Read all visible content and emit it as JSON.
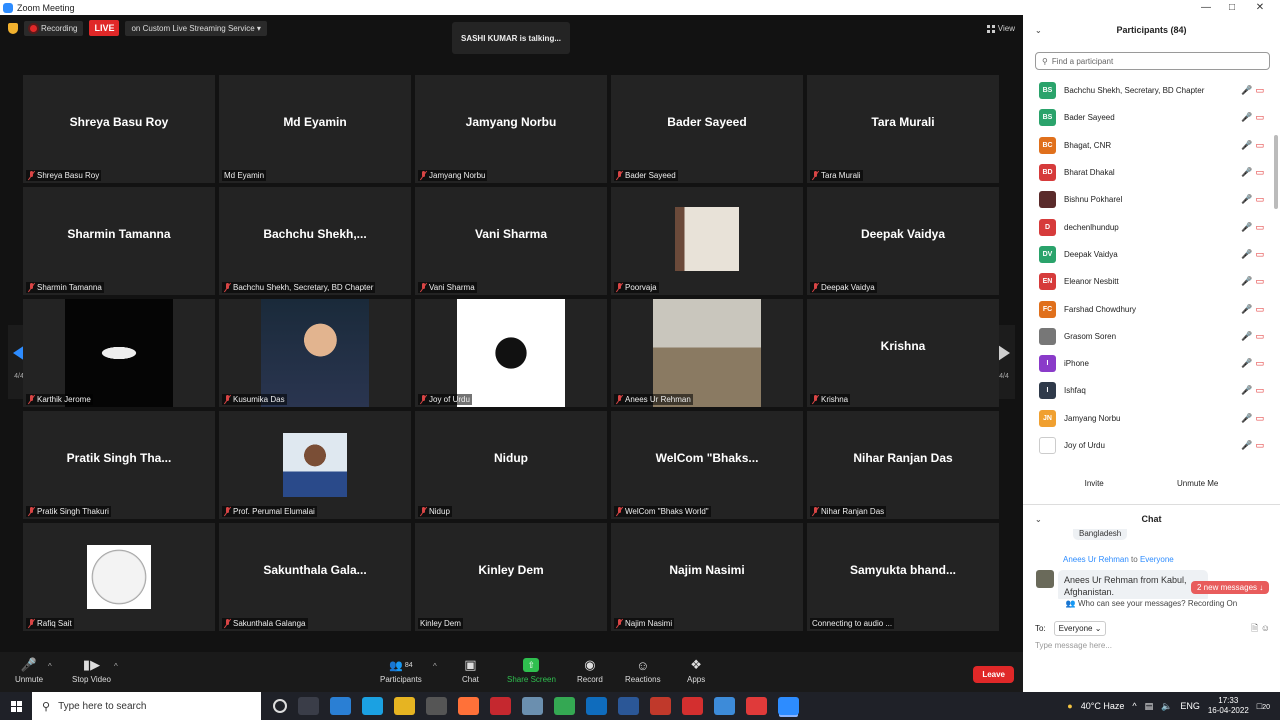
{
  "window": {
    "title": "Zoom Meeting"
  },
  "topbar": {
    "recording_label": "Recording",
    "live_label": "LIVE",
    "stream_label": "on Custom Live Streaming Service",
    "talking": "SASHI KUMAR is talking...",
    "view_label": "View"
  },
  "nav": {
    "page_left": "4/4",
    "page_right": "4/4"
  },
  "tiles": [
    {
      "big": "Shreya Basu Roy",
      "cap": "Shreya Basu Roy",
      "muted": true
    },
    {
      "big": "Md Eyamin",
      "cap": "Md Eyamin",
      "muted": false
    },
    {
      "big": "Jamyang Norbu",
      "cap": "Jamyang Norbu",
      "muted": true
    },
    {
      "big": "Bader Sayeed",
      "cap": "Bader Sayeed",
      "muted": true
    },
    {
      "big": "Tara Murali",
      "cap": "Tara Murali",
      "muted": true
    },
    {
      "big": "Sharmin Tamanna",
      "cap": "Sharmin Tamanna",
      "muted": true
    },
    {
      "big": "Bachchu  Shekh,...",
      "cap": "Bachchu Shekh, Secretary, BD Chapter",
      "muted": true
    },
    {
      "big": "Vani Sharma",
      "cap": "Vani Sharma",
      "muted": true
    },
    {
      "big": "",
      "cap": "Poorvaja",
      "muted": true,
      "pic": "photo-girl"
    },
    {
      "big": "Deepak Vaidya",
      "cap": "Deepak Vaidya",
      "muted": true
    },
    {
      "big": "",
      "cap": "Karthik Jerome",
      "muted": true,
      "pic": "batman"
    },
    {
      "big": "",
      "cap": "Kusumika Das",
      "muted": true,
      "pic": "photo-woman"
    },
    {
      "big": "",
      "cap": "Joy of Urdu",
      "muted": true,
      "pic": "urdu-logo"
    },
    {
      "big": "",
      "cap": "Anees Ur Rehman",
      "muted": true,
      "pic": "photo-landscape"
    },
    {
      "big": "Krishna",
      "cap": "Krishna",
      "muted": true
    },
    {
      "big": "Pratik Singh Tha...",
      "cap": "Pratik Singh Thakuri",
      "muted": true
    },
    {
      "big": "",
      "cap": "Prof. Perumal Elumalai",
      "muted": true,
      "pic": "photo-man"
    },
    {
      "big": "Nidup",
      "cap": "Nidup",
      "muted": true
    },
    {
      "big": "WelCom  \"Bhaks...",
      "cap": "WelCom \"Bhaks World\"",
      "muted": true
    },
    {
      "big": "Nihar Ranjan  Das",
      "cap": "Nihar Ranjan  Das",
      "muted": true
    },
    {
      "big": "",
      "cap": "Rafiq Sait",
      "muted": true,
      "pic": "football"
    },
    {
      "big": "Sakunthala  Gala...",
      "cap": "Sakunthala Galanga",
      "muted": true
    },
    {
      "big": "Kinley Dem",
      "cap": "Kinley Dem",
      "muted": false
    },
    {
      "big": "Najim Nasimi",
      "cap": "Najim Nasimi",
      "muted": true
    },
    {
      "big": "Samyukta  bhand...",
      "cap": "Connecting to audio ...",
      "muted": false
    }
  ],
  "toolbar": {
    "unmute": "Unmute",
    "stop_video": "Stop Video",
    "participants": "Participants",
    "participants_count": "84",
    "chat": "Chat",
    "share": "Share Screen",
    "record": "Record",
    "reactions": "Reactions",
    "apps": "Apps",
    "leave": "Leave"
  },
  "participants": {
    "title": "Participants (84)",
    "search_placeholder": "Find a participant",
    "items": [
      {
        "initials": "BS",
        "name": "Bachchu Shekh, Secretary, BD Chapter",
        "color": "#2aa36b"
      },
      {
        "initials": "BS",
        "name": "Bader Sayeed",
        "color": "#2aa36b"
      },
      {
        "initials": "BC",
        "name": "Bhagat, CNR",
        "color": "#e0701c"
      },
      {
        "initials": "BD",
        "name": "Bharat Dhakal",
        "color": "#d63b3b"
      },
      {
        "initials": "",
        "name": "Bishnu Pokharel",
        "color": "#5a2a2a"
      },
      {
        "initials": "D",
        "name": "dechenlhundup",
        "color": "#d63b3b"
      },
      {
        "initials": "DV",
        "name": "Deepak Vaidya",
        "color": "#2aa36b"
      },
      {
        "initials": "EN",
        "name": "Eleanor Nesbitt",
        "color": "#d63b3b"
      },
      {
        "initials": "FC",
        "name": "Farshad Chowdhury",
        "color": "#e0701c"
      },
      {
        "initials": "",
        "name": "Grasom Soren",
        "color": "#777777"
      },
      {
        "initials": "I",
        "name": "iPhone",
        "color": "#8a3bc9"
      },
      {
        "initials": "I",
        "name": "Ishfaq",
        "color": "#2f3a4a"
      },
      {
        "initials": "JN",
        "name": "Jamyang Norbu",
        "color": "#f0a030"
      },
      {
        "initials": "",
        "name": "Joy of Urdu",
        "color": "#ffffff"
      }
    ],
    "invite": "Invite",
    "unmute_me": "Unmute Me"
  },
  "chat": {
    "title": "Chat",
    "prev_text": "Bangladesh",
    "sender": "Anees Ur Rehman",
    "to_word": "to",
    "recipient": "Everyone",
    "message": "Anees Ur Rehman from Kabul, Afghanistan.",
    "new_messages": "2 new messages",
    "who_can_see": "Who can see your messages? Recording On",
    "to_label": "To:",
    "to_value": "Everyone",
    "input_placeholder": "Type message here..."
  },
  "taskbar": {
    "search_placeholder": "Type here to search",
    "weather": "40°C  Haze",
    "lang": "ENG",
    "time": "17:33",
    "date": "16-04-2022",
    "notifications": "20"
  },
  "colors": {
    "accent": "#2d8cff",
    "live_red": "#e02828",
    "share_green": "#2fbf4f"
  }
}
